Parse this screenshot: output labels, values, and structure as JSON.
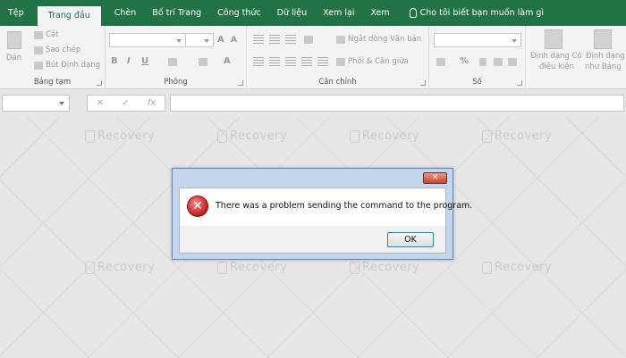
{
  "ribbon_tabs": [
    {
      "label": "Tệp"
    },
    {
      "label": "Trang đầu"
    },
    {
      "label": "Chèn"
    },
    {
      "label": "Bố trí Trang"
    },
    {
      "label": "Công thức"
    },
    {
      "label": "Dữ liệu"
    },
    {
      "label": "Xem lại"
    },
    {
      "label": "Xem"
    },
    {
      "label": "Cho tôi biết bạn muốn làm gì"
    }
  ],
  "clipboard": {
    "paste": "Dán",
    "cut": "Cắt",
    "copy": "Sao chép",
    "format_painter": "Bút Định dạng",
    "group_label": "Bảng tạm"
  },
  "font": {
    "bold": "B",
    "italic": "I",
    "underline": "U",
    "grow": "A",
    "group_label": "Phông"
  },
  "alignment": {
    "wrap_text": "Ngắt dòng Văn bản",
    "merge_center": "Phối & Căn giữa",
    "group_label": "Căn chỉnh"
  },
  "number": {
    "percent": "%",
    "group_label": "Số"
  },
  "styles": {
    "conditional_formatting_l1": "Định dạng Có",
    "conditional_formatting_l2": "điều kiện",
    "format_as_table_l1": "Định dạng",
    "format_as_table_l2": "như Bảng"
  },
  "formula_bar": {
    "fx": "fx"
  },
  "watermark": "Recovery",
  "dialog": {
    "close_label": "✕",
    "message": "There was a problem sending the command to the program.",
    "ok_label": "OK"
  },
  "colors": {
    "ribbon_green": "#217346",
    "dialog_frame": "#c4d6ec",
    "error_red": "#c61c1c"
  }
}
